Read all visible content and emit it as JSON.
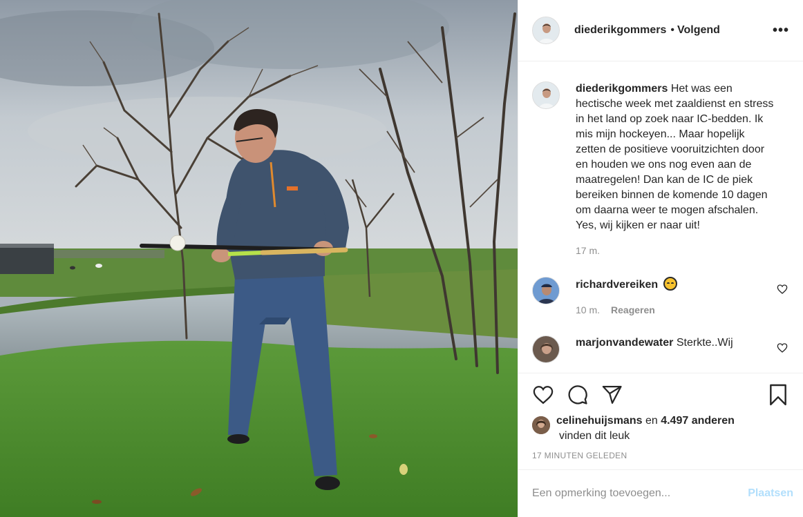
{
  "post": {
    "author": "diederikgommers",
    "separator": "•",
    "follow_label": "Volgend",
    "more_label": "•••",
    "photo_icon": "photo"
  },
  "caption": {
    "username": "diederikgommers",
    "text": "Het was een hectische week met zaaldienst en stress in het land op zoek naar IC-bedden. Ik mis mijn hockeyen... Maar hopelijk zetten de positieve vooruitzichten door en houden we ons nog even aan de maatregelen! Dan kan de IC de piek bereiken binnen de komende 10 dagen om daarna weer te mogen afschalen. Yes, wij kijken er naar uit!",
    "time": "17 m."
  },
  "comments": [
    {
      "username": "richardvereiken",
      "text": "",
      "emoji": "relieved-face-emoji",
      "time": "10 m.",
      "reply_label": "Reageren"
    },
    {
      "username": "marjonvandewater",
      "text": "Sterkte..Wij"
    }
  ],
  "likes": {
    "first_liker": "celinehuijsmans",
    "connector": "en",
    "count": "4.497 anderen",
    "suffix": "vinden dit leuk"
  },
  "timestamp": "17 MINUTEN GELEDEN",
  "add_comment": {
    "placeholder": "Een opmerking toevoegen...",
    "post_label": "Plaatsen"
  },
  "colors": {
    "text": "#262626",
    "muted": "#8e8e8e",
    "post_disabled": "#b2dffc",
    "border": "#efefef"
  }
}
